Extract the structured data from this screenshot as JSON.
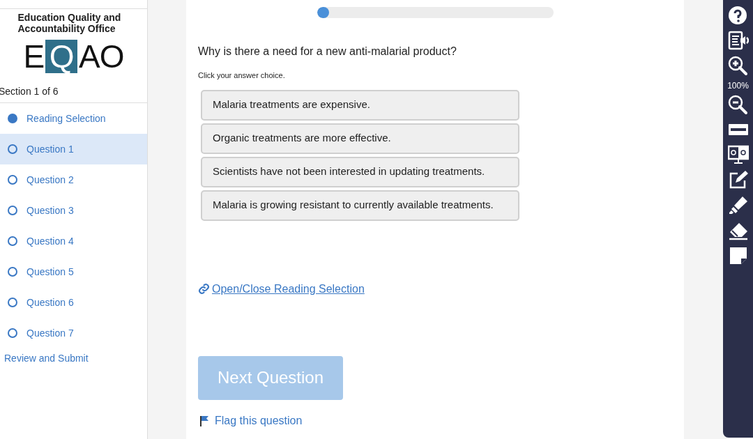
{
  "sidebar": {
    "org_name": "Education Quality and Accountability Office",
    "logo": [
      "E",
      "Q",
      "A",
      "O"
    ],
    "section": "Section 1 of 6",
    "items": [
      {
        "label": "Reading Selection",
        "filled": true,
        "selected": false
      },
      {
        "label": "Question 1",
        "filled": false,
        "selected": true
      },
      {
        "label": "Question 2",
        "filled": false,
        "selected": false
      },
      {
        "label": "Question 3",
        "filled": false,
        "selected": false
      },
      {
        "label": "Question 4",
        "filled": false,
        "selected": false
      },
      {
        "label": "Question 5",
        "filled": false,
        "selected": false
      },
      {
        "label": "Question 6",
        "filled": false,
        "selected": false
      },
      {
        "label": "Question 7",
        "filled": false,
        "selected": false
      }
    ],
    "review": "Review and Submit"
  },
  "progress": {
    "level": 0.05
  },
  "question": "Why is there a need for a new anti-malarial product?",
  "instruction": "Click your answer choice.",
  "choices": [
    {
      "label": "Malaria treatments are expensive.",
      "selected": false
    },
    {
      "label": "Organic treatments are more effective.",
      "selected": false
    },
    {
      "label": "Scientists have not been interested in updating treatments.",
      "selected": false
    },
    {
      "label": "Malaria is growing resistant to currently available treatments.",
      "selected": false
    }
  ],
  "reading_link": "Open/Close Reading Selection",
  "next_button": {
    "label": "Next Question",
    "disabled": true
  },
  "flag": "Flag this question",
  "toolbar": [
    {
      "kind": "help"
    },
    {
      "kind": "text-to-speech"
    },
    {
      "kind": "zoom-in"
    },
    {
      "kind": "zoom-level",
      "text": "100%"
    },
    {
      "kind": "zoom-out"
    },
    {
      "kind": "line-reader"
    },
    {
      "kind": "contrast"
    },
    {
      "kind": "notepad"
    },
    {
      "kind": "highlighter"
    },
    {
      "kind": "eraser"
    },
    {
      "kind": "sticky-note"
    }
  ]
}
